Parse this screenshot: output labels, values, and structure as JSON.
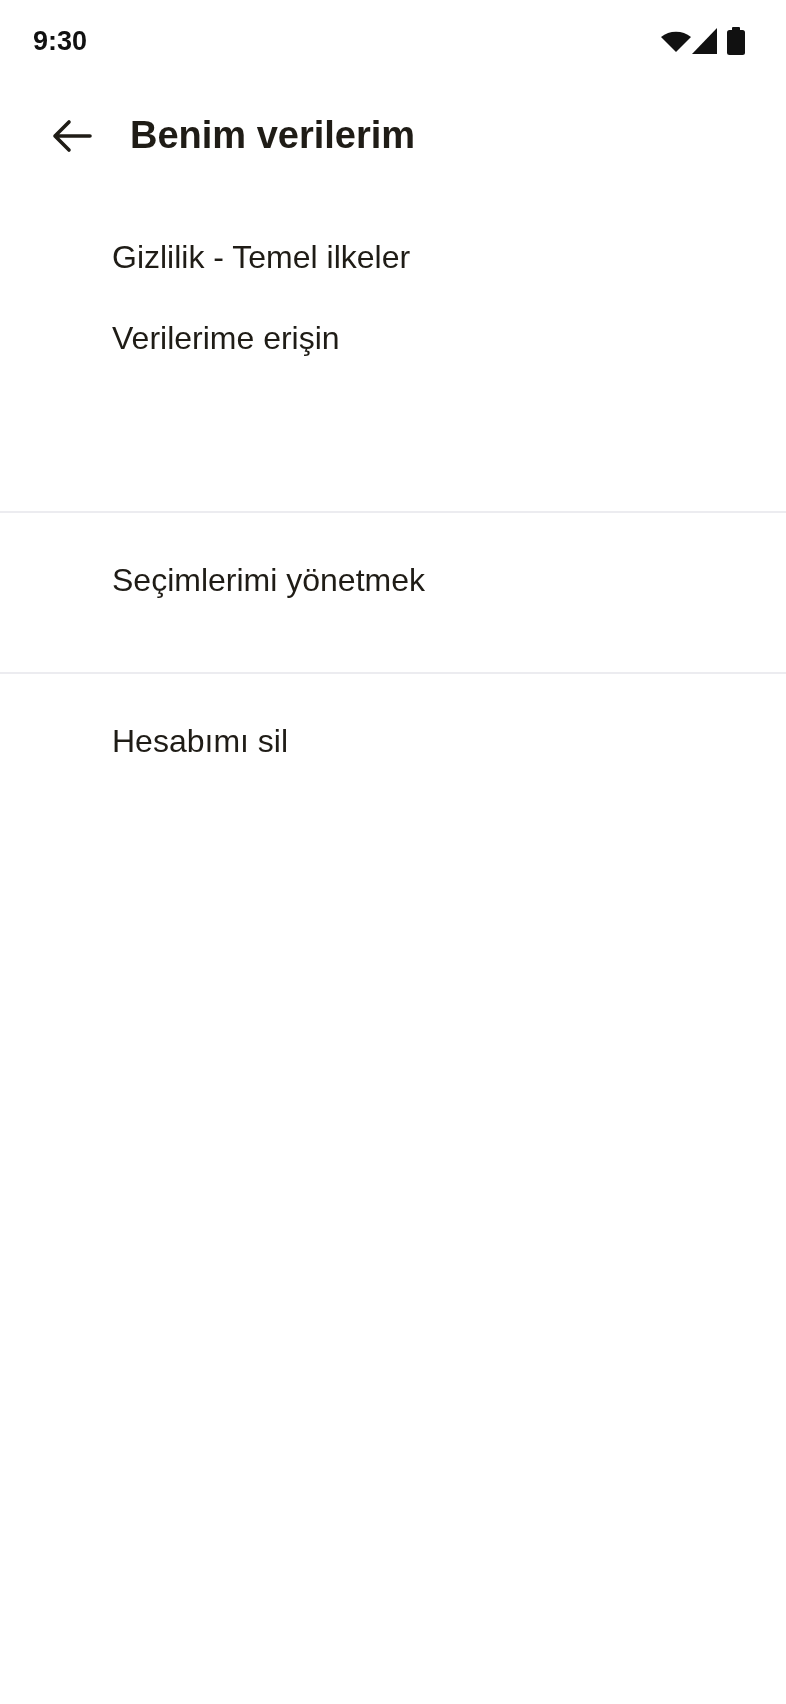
{
  "status_bar": {
    "time": "9:30"
  },
  "header": {
    "title": "Benim verilerim"
  },
  "sections": [
    {
      "items": [
        {
          "label": "Gizlilik - Temel ilkeler"
        },
        {
          "label": "Verilerime erişin"
        }
      ]
    },
    {
      "items": [
        {
          "label": "Seçimlerimi yönetmek"
        }
      ]
    },
    {
      "items": [
        {
          "label": "Hesabımı sil"
        }
      ]
    }
  ]
}
